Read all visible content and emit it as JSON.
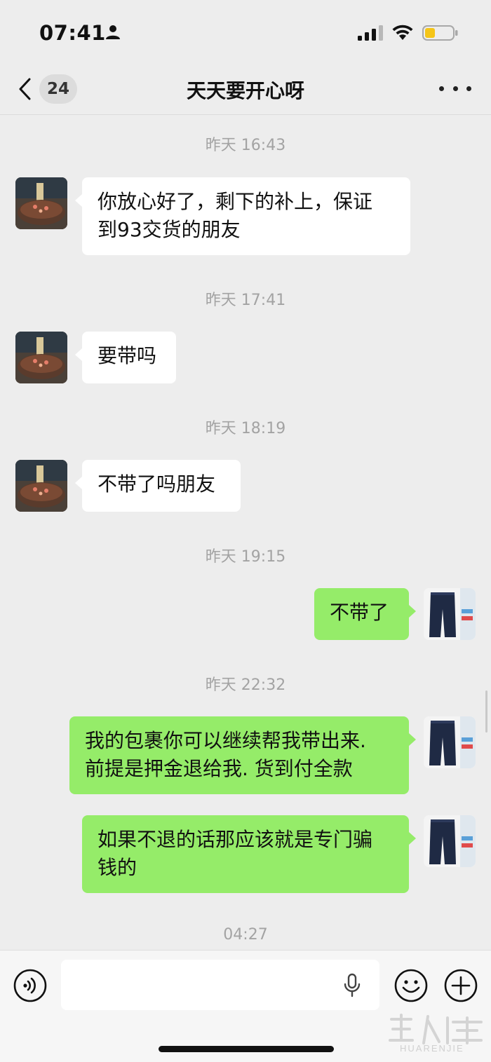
{
  "status_bar": {
    "time": "07:41",
    "battery_color": "#f5c518"
  },
  "header": {
    "unread_count": "24",
    "title": "天天要开心呀"
  },
  "messages": [
    {
      "type": "timestamp",
      "text": "昨天 16:43"
    },
    {
      "type": "incoming",
      "avatar": "cake-photo",
      "lines": [
        "你放心好了，剩下的补上，保证",
        "到93交货的朋友"
      ]
    },
    {
      "type": "timestamp",
      "text": "昨天 17:41"
    },
    {
      "type": "incoming",
      "avatar": "cake-photo",
      "lines": [
        "要带吗"
      ]
    },
    {
      "type": "timestamp",
      "text": "昨天 18:19"
    },
    {
      "type": "incoming",
      "avatar": "cake-photo",
      "lines": [
        "不带了吗朋友"
      ]
    },
    {
      "type": "timestamp",
      "text": "昨天 19:15"
    },
    {
      "type": "outgoing",
      "avatar": "pants-product-photo",
      "lines": [
        "不带了"
      ]
    },
    {
      "type": "timestamp",
      "text": "昨天 22:32"
    },
    {
      "type": "outgoing",
      "avatar": "pants-product-photo",
      "lines": [
        "我的包裹你可以继续帮我带出来.",
        "前提是押金退给我. 货到付全款"
      ]
    },
    {
      "type": "outgoing",
      "avatar": "pants-product-photo",
      "lines": [
        "如果不退的话那应该就是专门骗",
        "钱的"
      ]
    },
    {
      "type": "timestamp",
      "text": "04:27"
    }
  ],
  "input_bar": {
    "placeholder": ""
  },
  "watermark": {
    "text": "HUARENJIE"
  },
  "colors": {
    "background": "#ededed",
    "outgoing_bubble": "#95ec69",
    "incoming_bubble": "#ffffff",
    "timestamp_text": "#a3a3a3"
  }
}
